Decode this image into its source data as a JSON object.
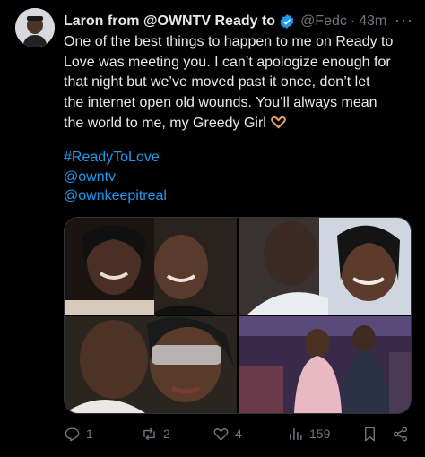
{
  "tweet": {
    "author_name": "Laron from @OWNTV Ready to",
    "handle": "@Fedc",
    "separator": "·",
    "time": "43m",
    "more": "···",
    "text_lines": [
      "One of the best things to happen to me on Ready to",
      "Love was meeting you. I can’t apologize enough for",
      "that night but we’ve moved past it once, don’t let",
      "the internet open old wounds. You’ll always mean",
      "the world to me, my Greedy Girl"
    ],
    "emoji": "heart-hands-emoji",
    "hashtag": "#ReadyToLove",
    "mentions": [
      "@owntv",
      "@ownkeepitreal"
    ]
  },
  "actions": {
    "replies": "1",
    "reposts": "2",
    "likes": "4",
    "views": "159"
  },
  "colors": {
    "background": "#000000",
    "text": "#e7e9ea",
    "muted": "#71767b",
    "link": "#1d9bf0",
    "verified": "#1d9bf0"
  },
  "icons": [
    "reply-icon",
    "repost-icon",
    "like-icon",
    "views-icon",
    "bookmark-icon",
    "share-icon",
    "verified-badge-icon",
    "more-icon"
  ]
}
